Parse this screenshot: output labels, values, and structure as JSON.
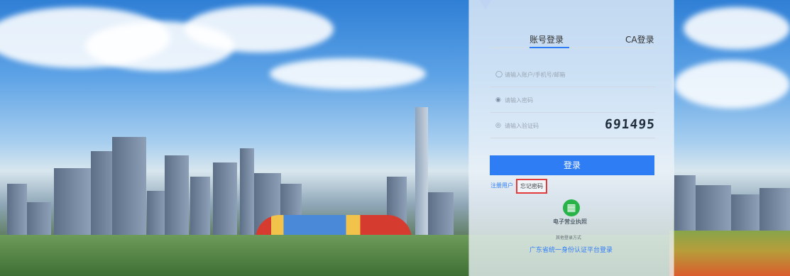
{
  "tabs": {
    "account_login": "账号登录",
    "ca_login": "CA登录"
  },
  "fields": {
    "account_placeholder": "请输入账户/手机号/邮箱",
    "password_placeholder": "请输入密码",
    "captcha_placeholder": "请输入验证码",
    "captcha_code": "691495"
  },
  "actions": {
    "login": "登录",
    "register": "注册用户",
    "forgot_password": "忘记密码"
  },
  "alternate": {
    "license_label": "电子营业执照",
    "other_methods": "其他登录方式",
    "guangdong_login": "广东省统一身份认证平台登录"
  },
  "icons": {
    "user": "user-icon",
    "lock": "lock-icon",
    "shield": "shield-icon",
    "license": "license-icon"
  },
  "colors": {
    "primary": "#2f7df5",
    "license": "#27b347",
    "highlight": "#e33b3b"
  }
}
